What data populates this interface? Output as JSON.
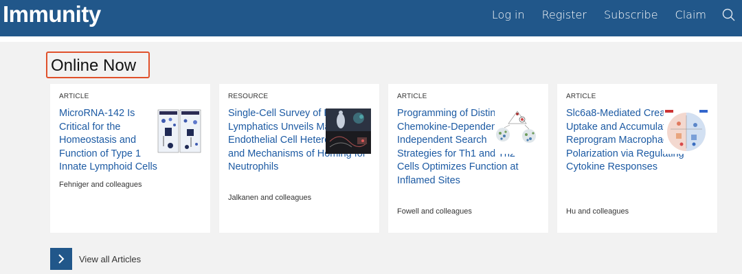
{
  "header": {
    "logo": "Immunity",
    "nav": [
      "Log in",
      "Register",
      "Subscribe",
      "Claim"
    ]
  },
  "section": {
    "title": "Online Now"
  },
  "cards": [
    {
      "type": "ARTICLE",
      "title": "MicroRNA-142 Is Critical for the Homeostasis and Function of Type 1 Innate Lymphoid Cells",
      "authors": "Fehniger and colleagues"
    },
    {
      "type": "RESOURCE",
      "title": "Single-Cell Survey of Human Lymphatics Unveils Marked Endothelial Cell Heterogeneity and Mechanisms of Homing for Neutrophils",
      "authors": "Jalkanen and colleagues"
    },
    {
      "type": "ARTICLE",
      "title": "Programming of Distinct Chemokine-Dependent and -Independent Search Strategies for Th1 and Th2 Cells Optimizes Function at Inflamed Sites",
      "authors": "Fowell and colleagues"
    },
    {
      "type": "ARTICLE",
      "title": "Slc6a8-Mediated Creatine Uptake and Accumulation Reprogram Macrophage Polarization via Regulating Cytokine Responses",
      "authors": "Hu and colleagues"
    }
  ],
  "view_all": {
    "label": "View all Articles"
  },
  "colors": {
    "brand": "#21578a",
    "link": "#1c5aa3",
    "highlight": "#e0502a"
  }
}
